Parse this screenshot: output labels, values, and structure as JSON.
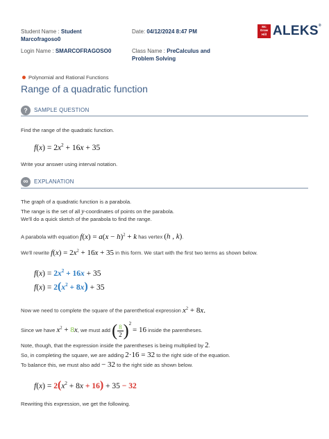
{
  "header": {
    "student_name_label": "Student Name :",
    "student_name_first": "Student",
    "student_name_second": "Marcofragoso0",
    "date_label": "Date:",
    "date_value": "04/12/2024 8:47 PM",
    "login_label": "Login Name :",
    "login_value": "SMARCOFRAGOSO0",
    "class_label": "Class Name :",
    "class_value_line1": "PreCalculus and",
    "class_value_line2": "Problem Solving",
    "logo_mc": "Mc",
    "logo_graw": "Graw",
    "logo_hill": "Hill",
    "logo_text": "ALEKS",
    "logo_reg": "®"
  },
  "breadcrumb": "Polynomial and Rational Functions",
  "page_title": "Range of a quadratic function",
  "sample": {
    "label": "SAMPLE QUESTION",
    "icon_glyph": "?",
    "prompt": "Find the range of the quadratic function.",
    "instruction": "Write your answer using interval notation."
  },
  "explanation": {
    "label": "EXPLANATION",
    "icon_glyph": "∞",
    "line1": "The graph of a quadratic function is a parabola.",
    "line2_pre": "The range is the set of all ",
    "line2_var": "y",
    "line2_post": "-coordinates of points on the parabola.",
    "line3": "We'll do a quick sketch of the parabola to find the range.",
    "line4_pre": "A parabola with equation ",
    "line4_mid": " has vertex ",
    "line5_pre": "We'll rewrite ",
    "line5_post": " in this form. We start with the first two terms as shown below.",
    "line6": "Now we need to complete the square of the parenthetical expression",
    "line7_pre": "Since we have ",
    "line7_mid": ", we must add ",
    "line7_post": " inside the parentheses.",
    "line8_pre": "Note, though, that the expression inside the parentheses is being multiplied by ",
    "line8_val": "2",
    "line9_pre": "So, in completing the square, we are adding ",
    "line9_expr": "2·16 = 32",
    "line9_post": " to the right side of the equation.",
    "line10_pre": "To balance this, we must also add ",
    "line10_expr": "− 32",
    "line10_post": " to the right side as shown below.",
    "line11": "Rewriting this expression, we get the following."
  }
}
